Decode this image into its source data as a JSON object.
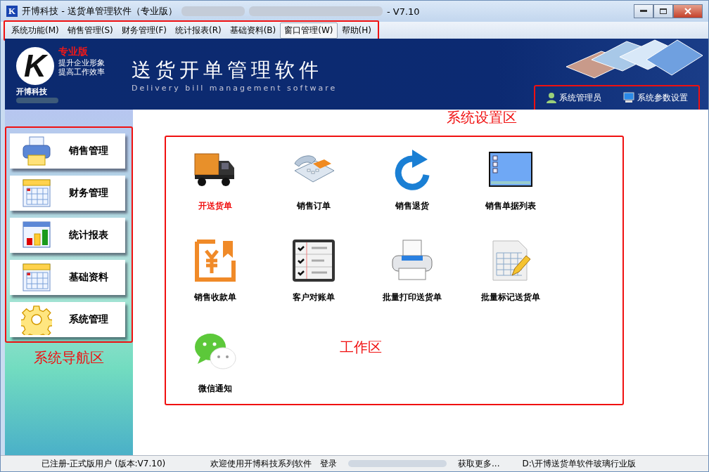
{
  "window": {
    "app_icon": "K",
    "title": "开博科技 - 送货单管理软件（专业版）",
    "version": "- V7.10"
  },
  "menu": {
    "outlined": true,
    "items": [
      {
        "label": "系统功能(M)",
        "selected": false
      },
      {
        "label": "销售管理(S)",
        "selected": false
      },
      {
        "label": "财务管理(F)",
        "selected": false
      },
      {
        "label": "统计报表(R)",
        "selected": false
      },
      {
        "label": "基础资料(B)",
        "selected": false
      },
      {
        "label": "窗口管理(W)",
        "selected": true
      },
      {
        "label": "帮助(H)",
        "selected": false
      }
    ]
  },
  "banner": {
    "logo_letter": "K",
    "edition": "专业版",
    "slogans": [
      "提升企业形象",
      "提高工作效率"
    ],
    "company": "开博科技",
    "title": "送货开单管理软件",
    "subtitle": "Delivery bill management software"
  },
  "settings_area": {
    "outlined": true,
    "annotation": "系统设置区",
    "links": [
      {
        "label": "系统管理员"
      },
      {
        "label": "系统参数设置"
      }
    ]
  },
  "nav": {
    "outlined": true,
    "annotation": "系统导航区",
    "items": [
      {
        "label": "销售管理"
      },
      {
        "label": "财务管理"
      },
      {
        "label": "统计报表"
      },
      {
        "label": "基础资料"
      },
      {
        "label": "系统管理"
      }
    ]
  },
  "work_area": {
    "outlined": true,
    "annotation": "工作区",
    "items": [
      {
        "label": "开送货单",
        "selected": true
      },
      {
        "label": "销售订单",
        "selected": false
      },
      {
        "label": "销售退货",
        "selected": false
      },
      {
        "label": "销售单据列表",
        "selected": false
      },
      {
        "label": "销售收款单",
        "selected": false
      },
      {
        "label": "客户对账单",
        "selected": false
      },
      {
        "label": "批量打印送货单",
        "selected": false
      },
      {
        "label": "批量标记送货单",
        "selected": false
      },
      {
        "label": "微信通知",
        "selected": false
      }
    ]
  },
  "status_bar": [
    "已注册-正式版用户 (版本:V7.10)",
    "欢迎使用开博科技系列软件",
    "登录",
    "获取更多...",
    "D:\\开博送货单软件玻璃行业版"
  ]
}
